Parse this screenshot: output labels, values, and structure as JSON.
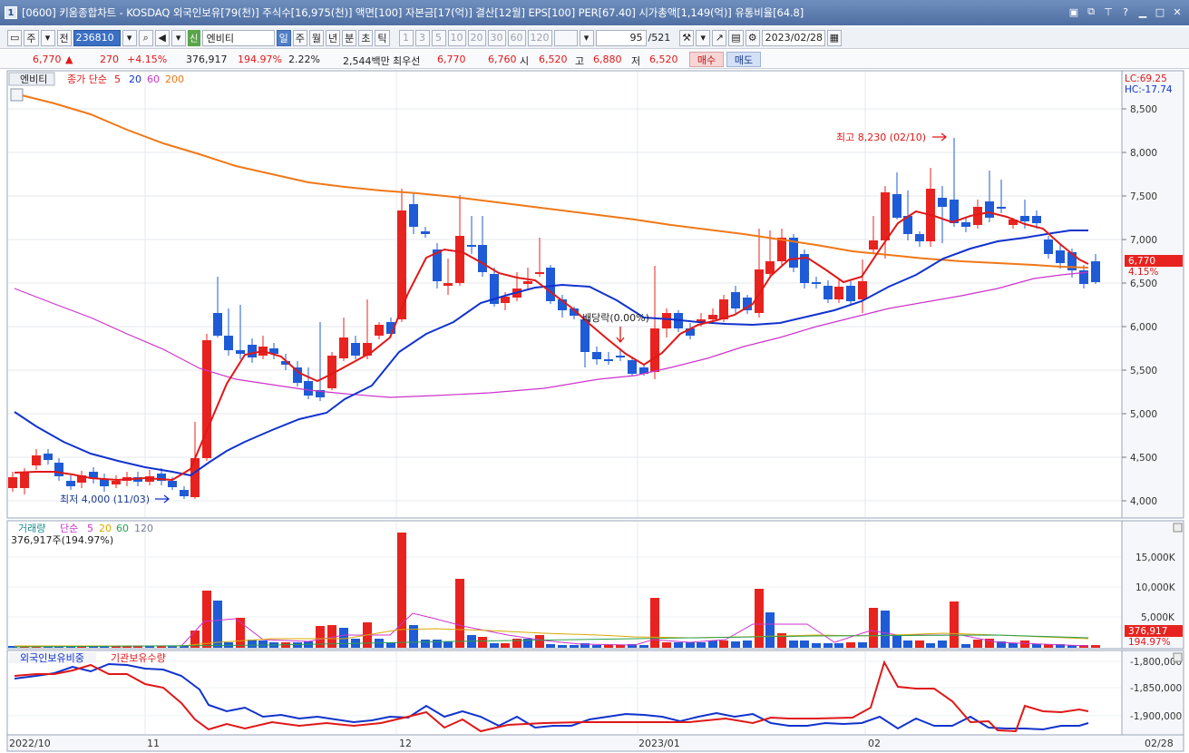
{
  "window": {
    "title": "[0600] 키움종합차트 - KOSDAQ 외국인보유[79(천)] 주식수[16,975(천)] 액면[100] 자본금[17(억)] 결산[12월] EPS[100] PER[67.40] 시가총액[1,149(억)] 유통비율[64.8]",
    "app_icon": "1"
  },
  "toolbar": {
    "period_main": "주",
    "prev_label": "전",
    "code": "236810",
    "stock_name": "엔비티",
    "new_badge": "신",
    "period_tabs": [
      "일",
      "주",
      "월",
      "년",
      "분",
      "초",
      "틱"
    ],
    "active_period": "일",
    "interval_buttons": [
      "1",
      "3",
      "5",
      "10",
      "20",
      "30",
      "60",
      "120"
    ],
    "count": "95",
    "total": "/521",
    "date": "2023/02/28"
  },
  "quote": {
    "price": "6,770",
    "arrow": "▲",
    "change": "270",
    "change_pct": "+4.15%",
    "volume": "376,917",
    "vol_ratio": "194.97%",
    "turnover": "2.22%",
    "amount": "2,544백만",
    "best_label": "최우선",
    "best_ask": "6,770",
    "best_bid": "6,760",
    "open_label": "시",
    "open": "6,520",
    "high_label": "고",
    "high": "6,880",
    "low_label": "저",
    "low": "6,520",
    "buy_label": "매수",
    "sell_label": "매도"
  },
  "price_panel": {
    "stock_tag": "엔비티",
    "legend": {
      "label": "종가 단순",
      "periods": [
        "5",
        "20",
        "60",
        "200"
      ]
    },
    "lc_label": "LC:69.25",
    "hc_label": "HC:-17.74",
    "current_price": "6,770",
    "current_pct": "4.15%",
    "max_annotation": "최고 8,230 (02/10)",
    "min_annotation": "최저 4,000 (11/03)",
    "dividend_annotation": "배당락(0.00%)",
    "y_ticks": [
      "8,500",
      "8,000",
      "7,500",
      "7,000",
      "6,500",
      "6,000",
      "5,500",
      "5,000",
      "4,500",
      "4,000"
    ]
  },
  "volume_panel": {
    "legend_title": "거래량",
    "legend": {
      "label": "단순",
      "periods": [
        "5",
        "20",
        "60",
        "120"
      ]
    },
    "current_text": "376,917주(194.97%)",
    "y_ticks": [
      "15,000K",
      "10,000K",
      "5,000K"
    ],
    "current_value": "376,917",
    "current_pct": "194.97%"
  },
  "investor_panel": {
    "legend_foreign": "외국인보유비중",
    "legend_inst": "기관보유수량",
    "y_ticks": [
      "-1,800,000",
      "-1,850,000",
      "-1,900,000"
    ]
  },
  "x_axis": {
    "labels": [
      "2022/10",
      "11",
      "12",
      "2023/01",
      "02",
      "02/28"
    ]
  },
  "colors": {
    "up": "#e8231f",
    "down": "#1f5bd6",
    "ma5": "#e01818",
    "ma20": "#1133cc",
    "ma60": "#cc33cc",
    "ma200": "#f07818",
    "title_bg": "#4f6fa3"
  }
}
